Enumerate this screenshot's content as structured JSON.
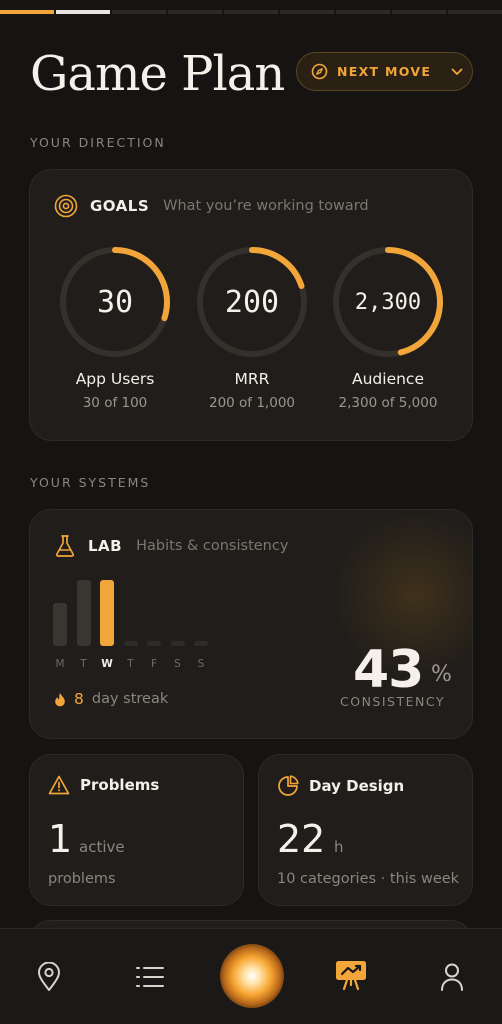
{
  "header": {
    "title": "Game Plan",
    "next_move_label": "NEXT MOVE"
  },
  "progress_segments": {
    "total": 9,
    "completed": 1,
    "current": 2
  },
  "sections": {
    "direction": "YOUR DIRECTION",
    "systems": "YOUR SYSTEMS"
  },
  "goals": {
    "label": "GOALS",
    "subtitle": "What you’re working toward",
    "items": [
      {
        "value_text": "30",
        "label": "App Users",
        "progress_text": "30 of 100",
        "fraction": 0.3
      },
      {
        "value_text": "200",
        "label": "MRR",
        "progress_text": "200 of 1,000",
        "fraction": 0.2
      },
      {
        "value_text": "2,300",
        "label": "Audience",
        "progress_text": "2,300 of 5,000",
        "fraction": 0.46
      }
    ]
  },
  "lab": {
    "label": "LAB",
    "subtitle": "Habits & consistency",
    "days": [
      {
        "letter": "M",
        "level": 0.65,
        "state": "done"
      },
      {
        "letter": "T",
        "level": 1.0,
        "state": "done"
      },
      {
        "letter": "W",
        "level": 1.0,
        "state": "today"
      },
      {
        "letter": "T",
        "level": 0.0,
        "state": "empty"
      },
      {
        "letter": "F",
        "level": 0.0,
        "state": "empty"
      },
      {
        "letter": "S",
        "level": 0.0,
        "state": "empty"
      },
      {
        "letter": "S",
        "level": 0.0,
        "state": "empty"
      }
    ],
    "streak_count": "8",
    "streak_text": "day streak",
    "consistency_value": "43",
    "consistency_unit": "%",
    "consistency_label": "CONSISTENCY"
  },
  "problems": {
    "title": "Problems",
    "count": "1",
    "count_label": "active",
    "subtitle": "problems"
  },
  "day_design": {
    "title": "Day Design",
    "value": "22",
    "unit": "h",
    "subtitle": "10 categories · this week"
  },
  "nav": {
    "items": [
      "map-pin-icon",
      "list-icon",
      "glow-orb",
      "game-plan-icon",
      "profile-icon"
    ],
    "active": "game-plan-icon"
  },
  "colors": {
    "accent": "#f2a63a",
    "background": "#161412",
    "card": "#201d1a",
    "muted": "#8b857e"
  }
}
